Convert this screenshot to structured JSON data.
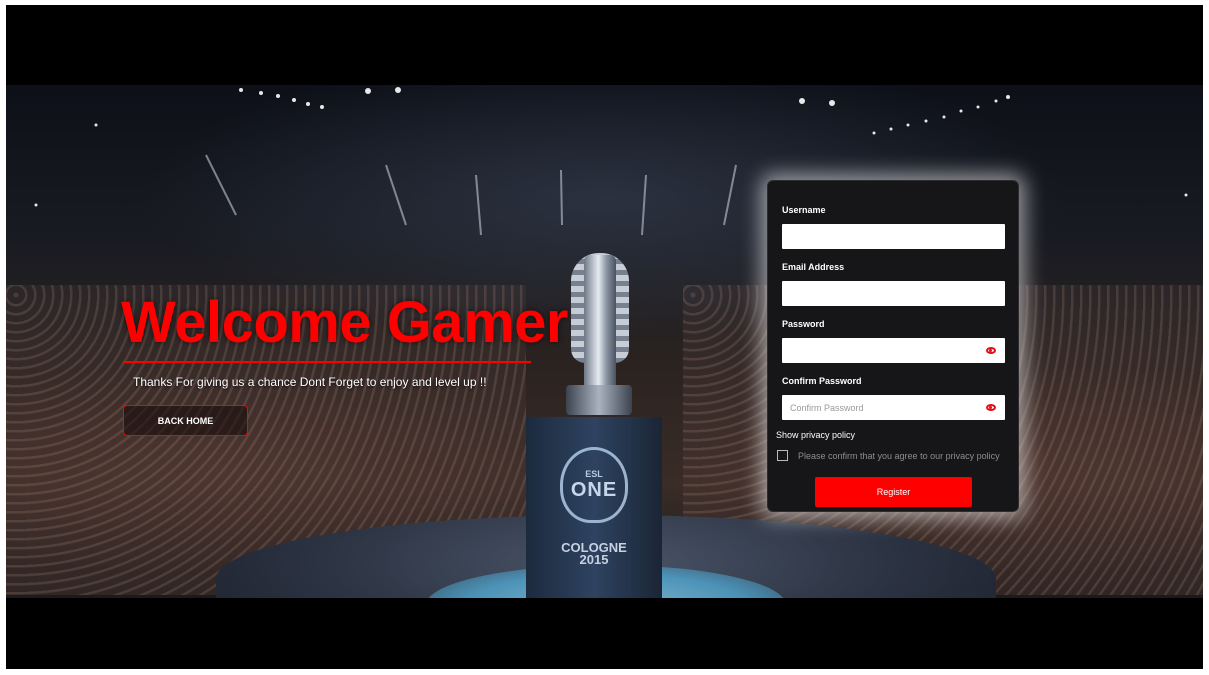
{
  "hero": {
    "title": "Welcome Gamer",
    "subtitle": "Thanks For giving us a chance Dont Forget to enjoy and level up !!",
    "back_home_label": "BACK HOME"
  },
  "backdrop": {
    "badge_small": "ESL",
    "badge_big": "ONE",
    "event_line1": "COLOGNE",
    "event_line2": "2015"
  },
  "form": {
    "username_label": "Username",
    "username_value": "",
    "email_label": "Email Address",
    "email_value": "",
    "password_label": "Password",
    "password_value": "",
    "confirm_label": "Confirm Password",
    "confirm_placeholder": "Confirm Password",
    "privacy_link": "Show privacy policy",
    "privacy_confirm": "Please confirm that you agree to our privacy policy",
    "privacy_checked": false,
    "register_label": "Register"
  },
  "colors": {
    "accent": "#ff0000",
    "panel_bg": "#161618",
    "eye_icon": "#e0101a"
  },
  "icons": {
    "password_toggle": "eye-icon",
    "confirm_toggle": "eye-icon"
  }
}
